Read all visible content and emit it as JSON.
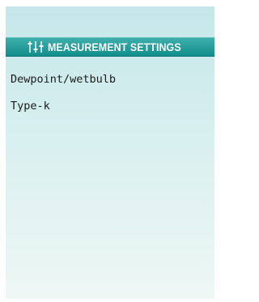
{
  "header": {
    "title": "MEASUREMENT SETTINGS",
    "icon": "sliders-icon"
  },
  "menu": {
    "items": [
      {
        "label": "Dewpoint/wetbulb"
      },
      {
        "label": "Type-k"
      }
    ]
  }
}
